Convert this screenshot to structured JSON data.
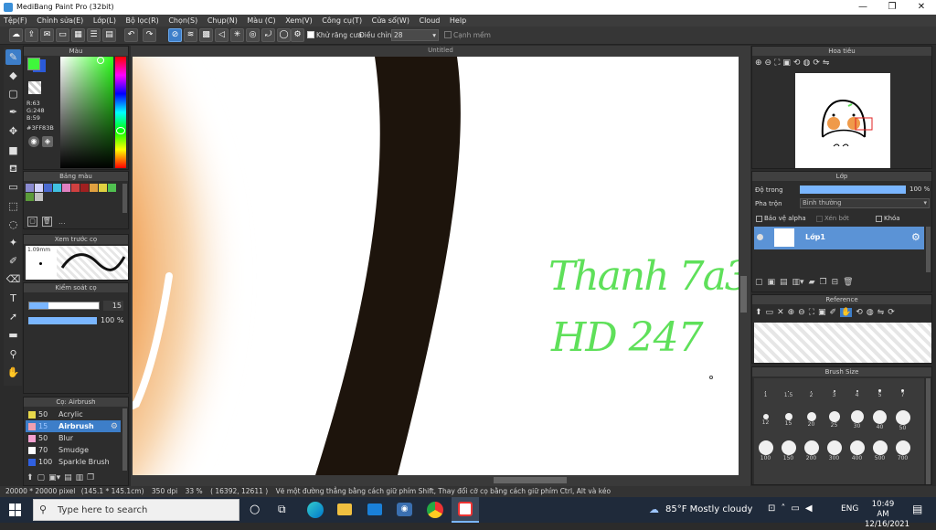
{
  "window": {
    "title": "MediBang Paint Pro (32bit)"
  },
  "menu": [
    "Tệp(F)",
    "Chỉnh sửa(E)",
    "Lớp(L)",
    "Bộ lọc(R)",
    "Chọn(S)",
    "Chụp(N)",
    "Màu (C)",
    "Xem(V)",
    "Công cụ(T)",
    "Cửa sổ(W)",
    "Cloud",
    "Help"
  ],
  "toolbar": {
    "antialias_label": "Khử răng cưa",
    "adjust_label": "Điều chỉnh",
    "adjust_value": "28",
    "smooth_label": "Cạnh mềm"
  },
  "canvas": {
    "tab_title": "Untitled",
    "text_line1": "Thanh 7a3",
    "text_line2": "HD 247",
    "text_color": "#5fe05a"
  },
  "color_panel": {
    "title": "Màu",
    "r": "R:63",
    "g": "G:248",
    "b": "B:59",
    "hex": "#3FF83B",
    "primary": "#3ff83b",
    "secondary": "#2a5ad8"
  },
  "palette_panel": {
    "title": "Bảng màu",
    "more": "..."
  },
  "brush_preview": {
    "title": "Xem trước cọ",
    "size": "1.09mm"
  },
  "brush_control": {
    "title": "Kiểm soát cọ",
    "size_value": "15",
    "opacity_value": "100 %",
    "size_fraction": 0.15,
    "opacity_fraction": 1.0
  },
  "brush_list": {
    "title": "Cọ: Airbrush",
    "items": [
      {
        "size": "50",
        "name": "Acrylic",
        "color": "#e8d84a"
      },
      {
        "size": "15",
        "name": "Airbrush",
        "color": "#f0a0b0"
      },
      {
        "size": "50",
        "name": "Blur",
        "color": "#f5a0d0"
      },
      {
        "size": "70",
        "name": "Smudge",
        "color": "#ffffff"
      },
      {
        "size": "100",
        "name": "Sparkle Brush",
        "color": "#3060e0"
      }
    ]
  },
  "navigator": {
    "title": "Hoa tiêu"
  },
  "layer_panel": {
    "title": "Lớp",
    "opacity_label": "Độ trong",
    "opacity_value": "100 %",
    "blend_label": "Pha trộn",
    "blend_value": "Bình thường",
    "protect_alpha": "Bảo vệ alpha",
    "clipping": "Xén bớt",
    "lock": "Khóa",
    "layer_name": "Lớp1"
  },
  "reference_panel": {
    "title": "Reference"
  },
  "brush_size_panel": {
    "title": "Brush Size",
    "row1": [
      "1",
      "1.5",
      "2",
      "3",
      "4",
      "5",
      "7"
    ],
    "row2": [
      "12",
      "15",
      "20",
      "25",
      "30",
      "40",
      "50"
    ],
    "row3": [
      "100",
      "150",
      "200",
      "300",
      "400",
      "500",
      "700"
    ]
  },
  "status": {
    "size": "20000 * 20000 pixel",
    "mm": "(145.1 * 145.1cm)",
    "dpi": "350 dpi",
    "zoom": "33 %",
    "coords": "( 16392, 12611 )",
    "hint": "Vẽ một đường thẳng bằng cách giữ phím Shift, Thay đổi cỡ cọ bằng cách giữ phím Ctrl, Alt và kéo"
  },
  "taskbar": {
    "search_placeholder": "Type here to search",
    "weather": "85°F  Mostly cloudy",
    "lang": "ENG",
    "time": "10:49 AM",
    "date": "12/16/2021"
  }
}
